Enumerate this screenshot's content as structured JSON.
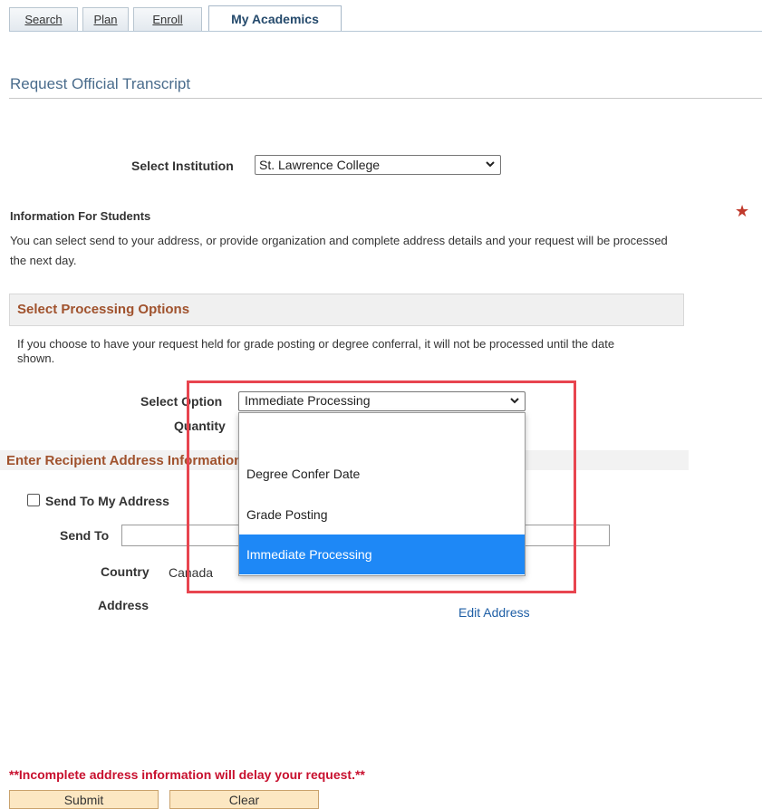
{
  "tabs": [
    {
      "label": "Search",
      "active": false
    },
    {
      "label": "Plan",
      "active": false
    },
    {
      "label": "Enroll",
      "active": false
    },
    {
      "label": "My Academics",
      "active": true
    }
  ],
  "page": {
    "title": "Request Official Transcript"
  },
  "institution": {
    "label": "Select Institution",
    "value": "St. Lawrence College"
  },
  "info": {
    "title": "Information For Students",
    "text": "You can select send to your address, or provide organization and complete address details and your request will be processed the next day."
  },
  "processing": {
    "section_title": "Select Processing Options",
    "note": "If you choose to have your request held for grade posting or degree conferral, it will not be processed until the date shown.",
    "option_label": "Select Option",
    "option_value": "Immediate Processing",
    "quantity_label": "Quantity",
    "dropdown_options": [
      "",
      "Degree Confer Date",
      "Grade Posting",
      "Immediate Processing"
    ],
    "selected_option": "Immediate Processing"
  },
  "recipient": {
    "section_title": "Enter Recipient Address Information",
    "send_to_my_address_label": "Send To My Address",
    "send_to_label": "Send To",
    "send_to_value": "",
    "country_label": "Country",
    "country_value": "Canada",
    "address_label": "Address",
    "edit_address_link": "Edit Address"
  },
  "warning": "**Incomplete address information will delay your request.**",
  "buttons": {
    "submit": "Submit",
    "clear": "Clear"
  },
  "colors": {
    "accent_section": "#a0522d",
    "selected_option_bg": "#1e88f6",
    "highlight_border": "#e8454f",
    "warning": "#c8102e"
  }
}
